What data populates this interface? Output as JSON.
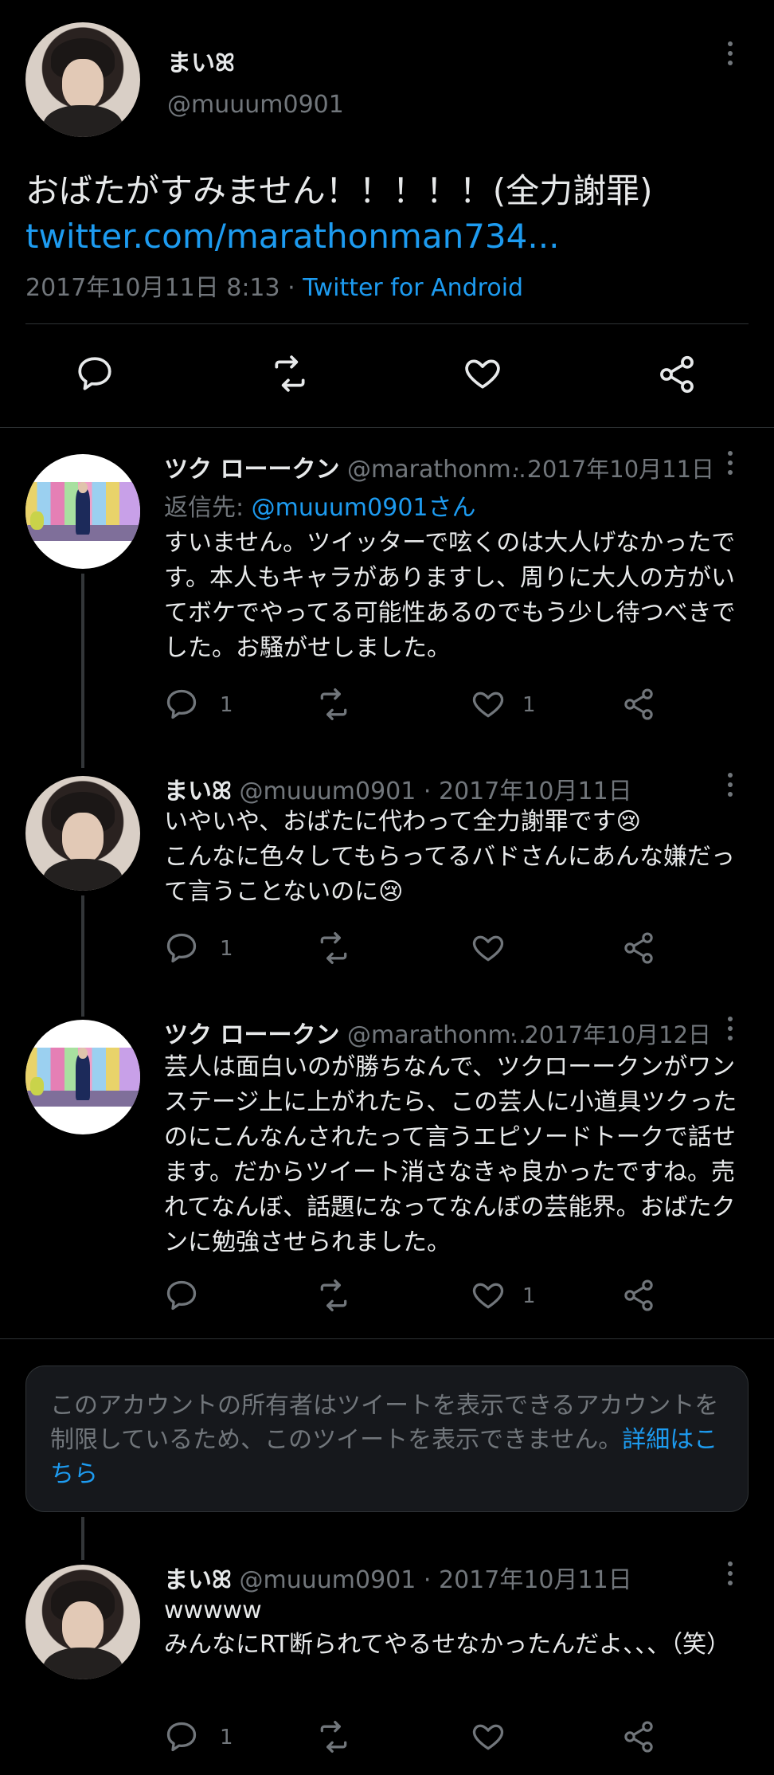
{
  "main_tweet": {
    "name": "まいꕤ",
    "handle": "@muuum0901",
    "text": "おばたがすみません！！！！！(全力謝罪)",
    "link": "twitter.com/marathonman734...",
    "timestamp": "2017年10月11日 8:13 · ",
    "client": "Twitter for Android"
  },
  "replies": [
    {
      "name": "ツク ローークン",
      "handle": "@marathonm...",
      "date": "· 2017年10月11日",
      "reply_to_label": "返信先: ",
      "reply_to": "@muuum0901さん",
      "text": "すいません。ツイッターで呟くのは大人げなかったです。本人もキャラがありますし、周りに大人の方がいてボケでやってる可能性あるのでもう少し待つべきでした。お騒がせしました。",
      "reply_count": "1",
      "like_count": "1"
    },
    {
      "name": "まいꕤ",
      "handle": "@muuum0901",
      "date": "· 2017年10月11日",
      "text_line1": "いやいや、おばたに代わって全力謝罪です😢",
      "text_line2": "こんなに色々してもらってるバドさんにあんな嫌だって言うことないのに😢",
      "reply_count": "1"
    },
    {
      "name": "ツク ローークン",
      "handle": "@marathonm...",
      "date": "· 2017年10月12日",
      "text": "芸人は面白いのが勝ちなんで、ツクローークンがワンステージ上に上がれたら、この芸人に小道具ツクったのにこんなんされたって言うエピソードトークで話せます。だからツイート消さなきゃ良かったですね。売れてなんぼ、話題になってなんぼの芸能界。おばたクンに勉強させられました。",
      "like_count": "1"
    }
  ],
  "notice": {
    "text": "このアカウントの所有者はツイートを表示できるアカウントを制限しているため、このツイートを表示できません。",
    "link": "詳細はこちら"
  },
  "last_reply": {
    "name": "まいꕤ",
    "handle": "@muuum0901",
    "date": "· 2017年10月11日",
    "text_line1": "wwwww",
    "text_line2": "みんなにRT断られてやるせなかったんだよ、、、（笑）",
    "reply_count": "1"
  },
  "colors": {
    "background": "#000000",
    "text": "#e7e9ea",
    "muted": "#71767b",
    "link": "#1d9bf0"
  },
  "icons": [
    "reply-icon",
    "retweet-icon",
    "like-icon",
    "share-icon",
    "more-icon"
  ]
}
